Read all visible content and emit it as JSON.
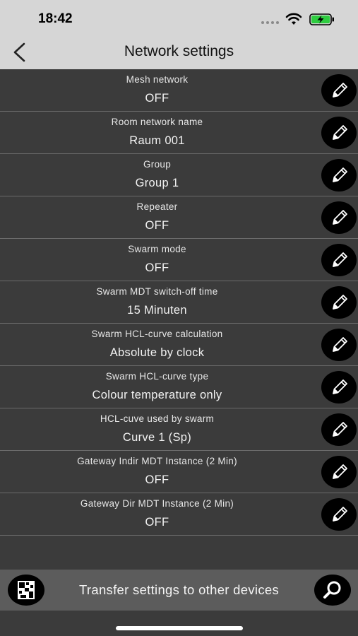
{
  "status_bar": {
    "time": "18:42",
    "icons": [
      "signal-dots-icon",
      "wifi-icon",
      "battery-charging-icon"
    ],
    "battery_color": "#2ecc40"
  },
  "nav": {
    "title": "Network settings",
    "back_icon": "chevron-left-icon"
  },
  "settings": [
    {
      "label": "Mesh network",
      "value": "OFF"
    },
    {
      "label": "Room network name",
      "value": "Raum 001"
    },
    {
      "label": "Group",
      "value": "Group 1"
    },
    {
      "label": "Repeater",
      "value": "OFF"
    },
    {
      "label": "Swarm mode",
      "value": "OFF"
    },
    {
      "label": "Swarm MDT switch-off time",
      "value": "15 Minuten"
    },
    {
      "label": "Swarm HCL-curve calculation",
      "value": "Absolute by clock"
    },
    {
      "label": "Swarm HCL-curve type",
      "value": "Colour temperature only"
    },
    {
      "label": "HCL-cuve used by swarm",
      "value": "Curve 1 (Sp)"
    },
    {
      "label": "Gateway Indir MDT Instance (2 Min)",
      "value": "OFF"
    },
    {
      "label": "Gateway Dir MDT Instance (2 Min)",
      "value": "OFF"
    }
  ],
  "row_icon": "pencil-icon",
  "bottom_bar": {
    "transfer_label": "Transfer settings to other devices",
    "left_icon": "qr-code-icon",
    "right_icon": "search-icon"
  }
}
